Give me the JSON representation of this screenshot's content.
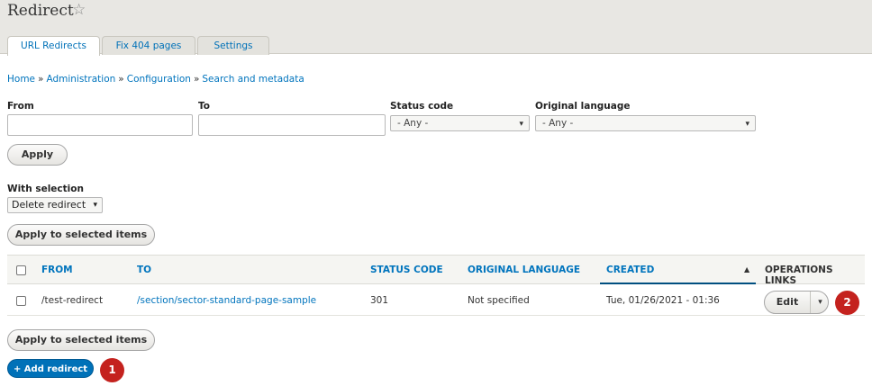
{
  "header": {
    "title": "Redirect",
    "favorite_icon": "☆",
    "tabs": [
      {
        "label": "URL Redirects"
      },
      {
        "label": "Fix 404 pages"
      },
      {
        "label": "Settings"
      }
    ]
  },
  "breadcrumb": {
    "items": [
      "Home",
      "Administration",
      "Configuration",
      "Search and metadata"
    ],
    "separator": "»"
  },
  "filters": {
    "from_label": "From",
    "from_value": "",
    "to_label": "To",
    "to_value": "",
    "status_label": "Status code",
    "status_value": "- Any -",
    "language_label": "Original language",
    "language_value": "- Any -",
    "apply_label": "Apply"
  },
  "bulk": {
    "label": "With selection",
    "action_value": "Delete redirect",
    "apply_label": "Apply to selected items"
  },
  "table": {
    "columns": [
      "FROM",
      "TO",
      "STATUS CODE",
      "ORIGINAL LANGUAGE",
      "CREATED",
      "OPERATIONS LINKS"
    ],
    "sort_icon": "▲",
    "rows": [
      {
        "from": "/test-redirect",
        "to": "/section/sector-standard-page-sample",
        "status": "301",
        "language": "Not specified",
        "created": "Tue, 01/26/2021 - 01:36",
        "edit_label": "Edit",
        "toggle_icon": "▾"
      }
    ]
  },
  "footer": {
    "apply_label": "Apply to selected items",
    "add_label": "+ Add redirect"
  },
  "callouts": [
    "1",
    "2"
  ],
  "colors": {
    "link": "#0074bd",
    "primary": "#0071b8",
    "callout": "#c4221e"
  },
  "icons": {
    "select_arrow": "▾"
  }
}
